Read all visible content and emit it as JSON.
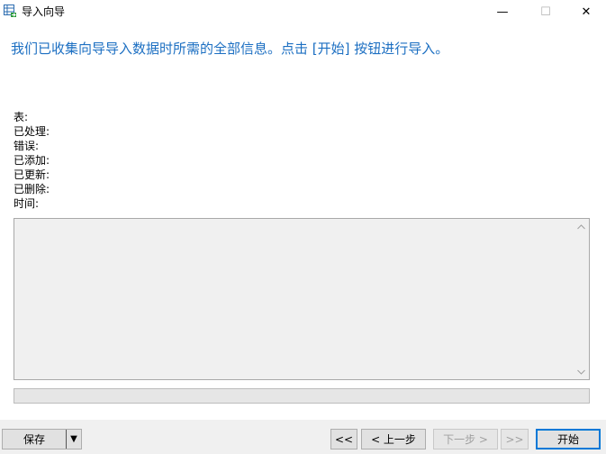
{
  "window": {
    "title": "导入向导",
    "minimize_label": "—",
    "maximize_label": "☐",
    "close_label": "✕"
  },
  "header": {
    "message": "我们已收集向导导入数据时所需的全部信息。点击 [开始] 按钮进行导入。"
  },
  "stats": [
    {
      "label": "表:"
    },
    {
      "label": "已处理:"
    },
    {
      "label": "错误:"
    },
    {
      "label": "已添加:"
    },
    {
      "label": "已更新:"
    },
    {
      "label": "已删除:"
    },
    {
      "label": "时间:"
    }
  ],
  "progress": {
    "value": 0
  },
  "footer": {
    "save_label": "保存",
    "save_dropdown_glyph": "▼",
    "first_label": "<<",
    "back_label": "< 上一步",
    "next_label": "下一步 >",
    "last_label": ">>",
    "start_label": "开始"
  },
  "colors": {
    "accent": "#1c6fc2",
    "default_button_border": "#0078d7"
  },
  "icons": {
    "app": "table-import-icon",
    "scroll_up": "scroll-up-arrow-icon",
    "scroll_down": "scroll-down-arrow-icon",
    "dropdown": "chevron-down-icon"
  }
}
